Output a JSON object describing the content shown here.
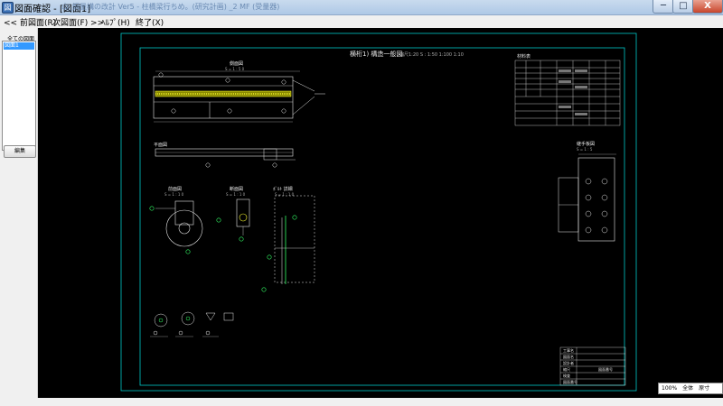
{
  "window": {
    "title": "図面確認 - [図面1]",
    "subtitle": "山_鋼量構の改計 Ver5 - 柱橋梁行ちめ。(研究計画) _2 MF (受量器)",
    "minimize": "─",
    "maximize": "□",
    "close": "X"
  },
  "menu": {
    "prev": "<< 前図面(R)",
    "next": "次図面(F) >>",
    "help": "ﾍﾙﾌﾟ(H)",
    "exit": "終了(X)"
  },
  "sidebar": {
    "label": "全ての図面",
    "items": [
      "図面1"
    ],
    "edit_button": "編集"
  },
  "drawing": {
    "main_title": "横桁1) 構造一般図",
    "main_title_scale": "縮尺1:20   S : 1:50   1:100  1:10",
    "view_side": "側面図",
    "view_side_scale": "S = 1 : 5 0",
    "view_plan": "平面図",
    "view_front": "前面図",
    "view_front_scale": "S = 1 : 1 0",
    "view_section": "断面図",
    "view_section_scale": "S = 1 : 1 0",
    "view_detail": "ﾎﾞﾙﾄ 詳細",
    "view_detail_scale": "S = 1 : 1 0",
    "view_plate": "継手板図",
    "view_plate_scale": "S = 1 : 5",
    "table_title": "材料表",
    "titleblock_rows": [
      "工事名",
      "図面名",
      "設計者",
      "縮尺",
      "検査",
      "図面番号"
    ],
    "titleblock_value": "図面番号"
  },
  "colors": {
    "drawing_bg": "#000000",
    "frame": "#00c8c8",
    "lines": "#e6e6e6",
    "highlight": "#ffff33",
    "green": "#33ff66",
    "selection": "#3399ff"
  },
  "zoom": {
    "value": "100%",
    "fit": "全体",
    "size": "原寸"
  }
}
